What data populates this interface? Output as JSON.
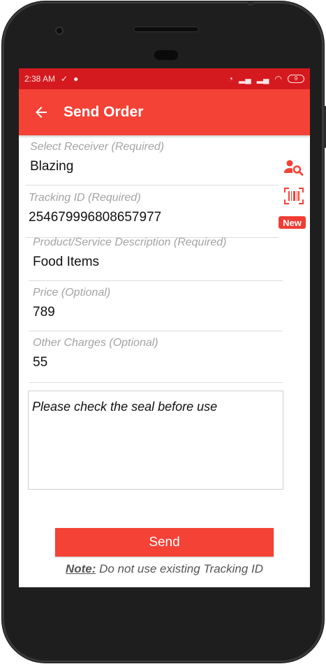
{
  "status_bar": {
    "time": "2:38 AM",
    "battery": "9"
  },
  "appbar": {
    "title": "Send Order",
    "color": "#f44236"
  },
  "form": {
    "receiver": {
      "label": "Select Receiver (Required)",
      "value": "Blazing"
    },
    "tracking": {
      "label": "Tracking ID (Required)",
      "value": "254679996808657977"
    },
    "description": {
      "label": "Product/Service Description (Required)",
      "value": "Food Items"
    },
    "price": {
      "label": "Price (Optional)",
      "value": "789"
    },
    "other_charges": {
      "label": "Other Charges (Optional)",
      "value": "55"
    },
    "notes": {
      "value": "Please check the seal before use"
    },
    "new_badge": "New"
  },
  "actions": {
    "send_label": "Send"
  },
  "note": {
    "key": "Note:",
    "text": " Do not use existing Tracking ID"
  },
  "icons": {
    "back": "arrow-left-icon",
    "receiver_search": "person-search-icon",
    "barcode": "barcode-scan-icon"
  },
  "colors": {
    "status_bar": "#d41a1f",
    "accent": "#f44236"
  }
}
